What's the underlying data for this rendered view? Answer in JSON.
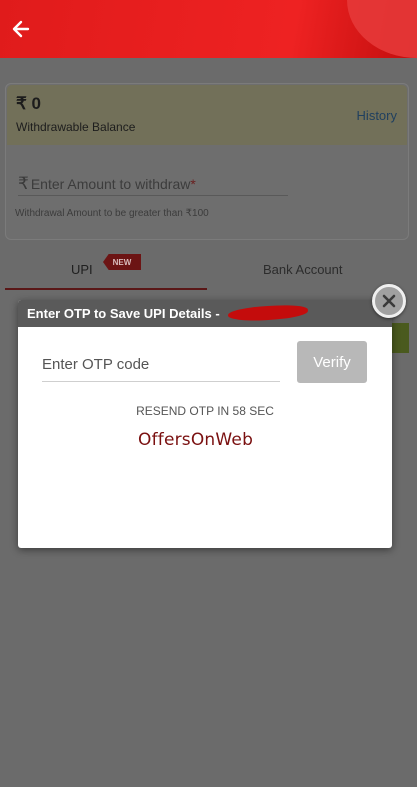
{
  "header": {
    "back_icon": "arrow-left-icon"
  },
  "balance": {
    "amount": "₹ 0",
    "label": "Withdrawable Balance",
    "history_link": "History"
  },
  "withdraw": {
    "rupee_symbol": "₹",
    "placeholder": "Enter Amount to withdraw",
    "required_mark": "*",
    "hint": "Withdrawal Amount to be greater than ₹100"
  },
  "tabs": {
    "upi": "UPI",
    "upi_badge": "NEW",
    "bank": "Bank Account"
  },
  "dialog": {
    "title": "Enter OTP to Save UPI Details - ",
    "otp_placeholder": "Enter OTP code",
    "verify_label": "Verify",
    "resend_text": "RESEND OTP IN 58 SEC",
    "watermark": "OffersOnWeb"
  },
  "colors": {
    "header_red": "#ee2222",
    "overlay": "#6a6a6a",
    "dialog_title_bg": "#5a5a5a",
    "verify_disabled": "#b8b8b8",
    "watermark": "#7a1010"
  }
}
